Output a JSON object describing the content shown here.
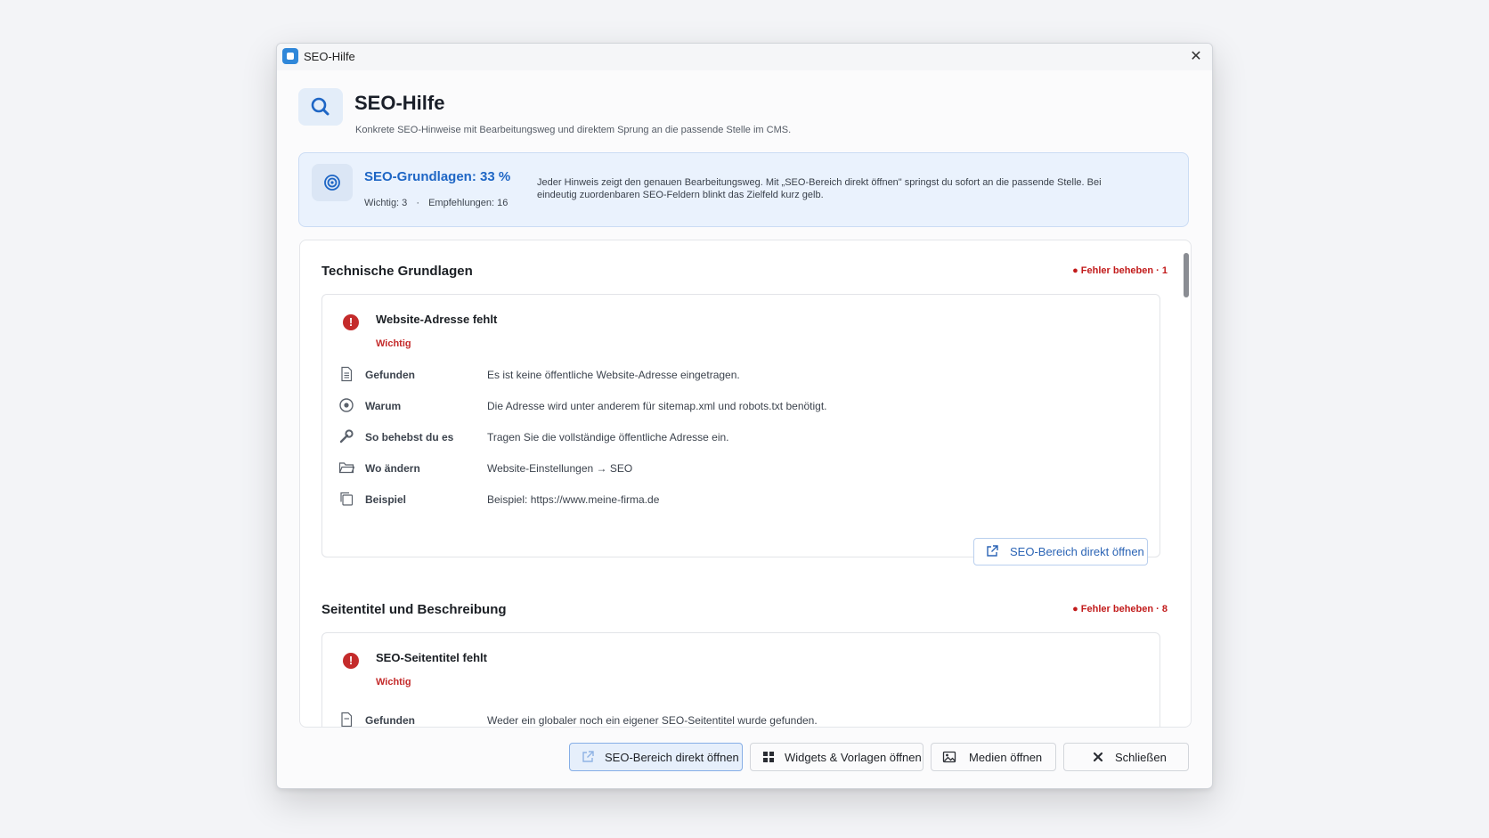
{
  "window": {
    "title": "SEO-Hilfe",
    "close_glyph": "✕"
  },
  "header": {
    "title": "SEO-Hilfe",
    "subtitle": "Konkrete SEO-Hinweise mit Bearbeitungsweg und direktem Sprung an die passende Stelle im CMS."
  },
  "summary": {
    "title": "SEO-Grundlagen: 33 %",
    "important": "Wichtig: 3",
    "separator": "·",
    "recommendations": "Empfehlungen: 16",
    "note": "Jeder Hinweis zeigt den genauen Bearbeitungsweg. Mit „SEO-Bereich direkt öffnen\" springst du sofort an die passende Stelle. Bei eindeutig zuordenbaren SEO-Feldern blinkt das Zielfeld kurz gelb."
  },
  "sections": [
    {
      "title": "Technische Grundlagen",
      "badge": "● Fehler beheben · 1",
      "issue": {
        "title": "Website-Adresse fehlt",
        "badge": "Wichtig",
        "rows": [
          {
            "icon": "document-icon",
            "label": "Gefunden",
            "value": "Es ist keine öffentliche Website-Adresse eingetragen."
          },
          {
            "icon": "target-icon",
            "label": "Warum",
            "value": "Die Adresse wird unter anderem für sitemap.xml und robots.txt benötigt."
          },
          {
            "icon": "wrench-icon",
            "label": "So behebst du es",
            "value": "Tragen Sie die vollständige öffentliche Adresse ein."
          },
          {
            "icon": "folder-icon",
            "label": "Wo ändern",
            "value": "Website-Einstellungen → SEO"
          },
          {
            "icon": "copy-icon",
            "label": "Beispiel",
            "value": "Beispiel: https://www.meine-firma.de"
          }
        ],
        "button": "SEO-Bereich direkt öffnen"
      }
    },
    {
      "title": "Seitentitel und Beschreibung",
      "badge": "● Fehler beheben · 8",
      "issue": {
        "title": "SEO-Seitentitel fehlt",
        "badge": "Wichtig",
        "rows": [
          {
            "icon": "document-icon",
            "label": "Gefunden",
            "value": "Weder ein globaler noch ein eigener SEO-Seitentitel wurde gefunden."
          }
        ]
      }
    }
  ],
  "footer": {
    "open_seo": "SEO-Bereich direkt öffnen",
    "widgets": "Widgets & Vorlagen öffnen",
    "media": "Medien öffnen",
    "close": "Schließen"
  },
  "colors": {
    "accent": "#1e66c5",
    "error": "#c42b2b",
    "summary_bg": "#eaf2fd"
  }
}
